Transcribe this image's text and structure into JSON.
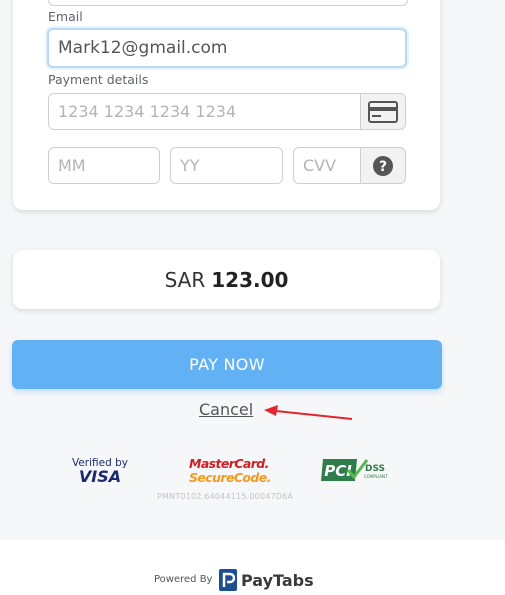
{
  "form": {
    "email_label": "Email",
    "email_value": "Mark12@gmail.com",
    "payment_label": "Payment details",
    "card_number_placeholder": "1234 1234 1234 1234",
    "month_placeholder": "MM",
    "year_placeholder": "YY",
    "cvv_placeholder": "CVV"
  },
  "amount": {
    "currency": "SAR",
    "value": "123.00"
  },
  "actions": {
    "pay_label": "PAY NOW",
    "cancel_label": "Cancel"
  },
  "badges": {
    "visa_line1": "Verified by",
    "visa_line2": "VISA",
    "mastercard_line1": "MasterCard.",
    "mastercard_line2": "SecureCode.",
    "pci_text": "PCI",
    "dss_text": "DSS",
    "compliant_text": "COMPLIANT"
  },
  "reference": "PMNT0102.64044115.00047D6A",
  "footer": {
    "powered_by": "Powered By",
    "brand": "PayTabs"
  },
  "colors": {
    "accent": "#62b1f5",
    "annotation_arrow": "#e3262e"
  }
}
